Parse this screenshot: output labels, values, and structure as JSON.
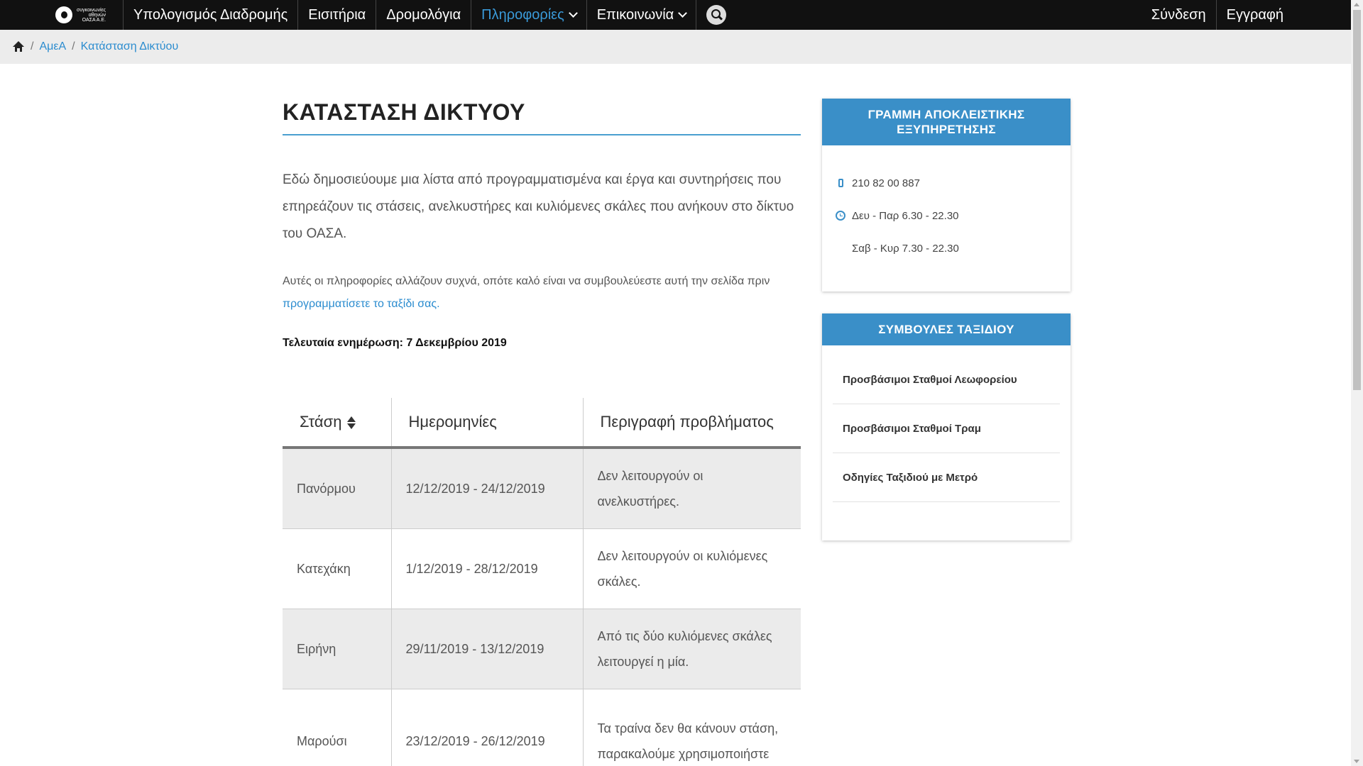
{
  "nav": {
    "logo_text": [
      "συγκοινωνίες",
      "αθηνών",
      "ΟΑΣΑ Α.Ε."
    ],
    "items": [
      {
        "label": "Υπολογισμός Διαδρομής"
      },
      {
        "label": "Εισιτήρια"
      },
      {
        "label": "Δρομολόγια"
      },
      {
        "label": "Πληροφορίες",
        "active": true
      },
      {
        "label": "Επικοινωνία"
      }
    ],
    "login": "Σύνδεση",
    "register": "Εγγραφή",
    "accent": "#3a9ad9"
  },
  "breadcrumb": {
    "items": [
      "ΑμεΑ",
      "Κατάσταση Δικτύου"
    ],
    "separator": "/"
  },
  "page": {
    "title": "ΚΑΤΑΣΤΑΣΗ ΔΙΚΤΥΟΥ",
    "lead": "Εδώ δημοσιεύουμε μια λίστα από προγραμματισμένα και έργα και συντηρήσεις που επηρεάζουν τις στάσεις, ανελκυστήρες και κυλιόμενες σκάλες που ανήκουν στο δίκτυο του ΟΑΣΑ.",
    "note_text": "Αυτές οι πληροφορίες αλλάζουν συχνά, οπότε καλό είναι να συμβουλεύεστε αυτή την σελίδα πριν",
    "note_link": "προγραμματίσετε το ταξίδι σας.",
    "updated": "Τελευταία ενημέρωση: 7 Δεκεμβρίου 2019"
  },
  "table": {
    "headers": [
      "Στάση",
      "Ημερομηνίες",
      "Περιγραφή προβλήματος"
    ],
    "rows": [
      {
        "station": "Πανόρμου",
        "dates": "12/12/2019 - 24/12/2019",
        "desc": "Δεν λειτουργούν οι ανελκυστήρες."
      },
      {
        "station": "Κατεχάκη",
        "dates": "1/12/2019 - 28/12/2019",
        "desc": "Δεν λειτουργούν οι κυλιόμενες σκάλες."
      },
      {
        "station": "Ειρήνη",
        "dates": "29/11/2019 - 13/12/2019",
        "desc": "Από τις δύο κυλιόμενες σκάλες λειτουργεί η μία."
      },
      {
        "station": "Μαρούσι",
        "dates": "23/12/2019 - 26/12/2019",
        "desc": "Τα τραίνα δεν θα κάνουν στάση, παρακαλούμε χρησιμοποιήστε"
      }
    ]
  },
  "sidebar": {
    "contact": {
      "title": "ΓΡΑΜΜΗ ΑΠΟΚΛΕΙΣΤΙΚΗΣ ΕΞΥΠΗΡΕΤΗΣΗΣ",
      "phone": "210 82 00 887",
      "hours_weekday": "Δευ - Παρ 6.30 - 22.30",
      "hours_weekend": "Σαβ - Κυρ 7.30 - 22.30"
    },
    "tips": {
      "title": "ΣΥΜΒΟΥΛΕΣ ΤΑΞΙΔΙΟΥ",
      "items": [
        "Προσβάσιμοι Σταθμοί Λεωφορείου",
        "Προσβάσιμοι Σταθμοί Τραμ",
        "Οδηγίες Ταξιδιού με Μετρό"
      ]
    }
  }
}
